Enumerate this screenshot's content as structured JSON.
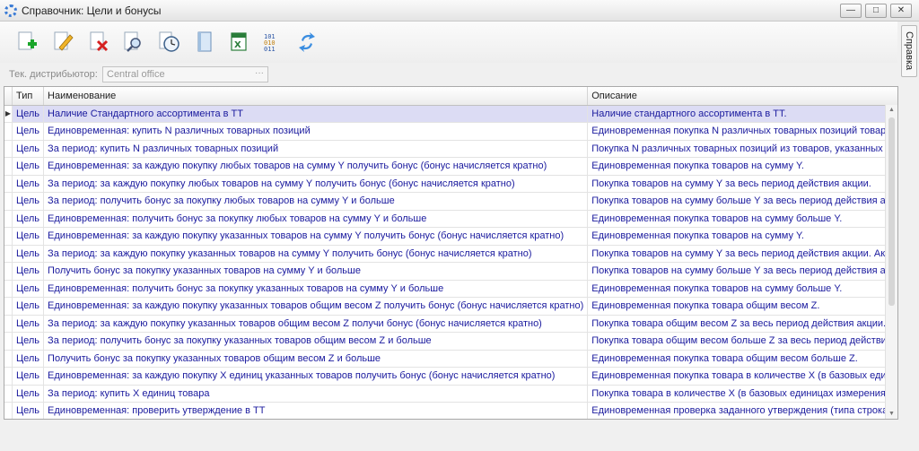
{
  "window": {
    "title": "Справочник: Цели и бонусы",
    "buttons": [
      "—",
      "□",
      "✕"
    ]
  },
  "toolbar": {
    "buttons": [
      {
        "icon": "add-icon"
      },
      {
        "icon": "edit-icon"
      },
      {
        "icon": "delete-icon"
      },
      {
        "icon": "search-edit-icon"
      },
      {
        "icon": "clock-icon"
      },
      {
        "icon": "book-icon"
      },
      {
        "icon": "excel-icon"
      },
      {
        "icon": "binary-icon"
      },
      {
        "icon": "refresh-icon"
      }
    ]
  },
  "distributor": {
    "label": "Тек. дистрибьютор:",
    "value": "Central office",
    "button": "···"
  },
  "side_tab": "Справка",
  "table": {
    "columns": [
      "Тип",
      "Наименование",
      "Описание"
    ],
    "rows": [
      {
        "type": "Цель",
        "name": "Наличие Стандартного ассортимента в ТТ",
        "desc": "Наличие стандартного ассортимента в ТТ."
      },
      {
        "type": "Цель",
        "name": "Единовременная: купить N различных товарных позиций",
        "desc": "Единовременная покупка N различных товарных позиций товаров, у..."
      },
      {
        "type": "Цель",
        "name": "За период: купить N различных товарных позиций",
        "desc": "Покупка N различных товарных позиций из товаров, указанных в це..."
      },
      {
        "type": "Цель",
        "name": "Единовременная: за каждую покупку любых товаров на сумму Y получить бонус (бонус начисляется кратно)",
        "desc": "Единовременная покупка товаров на сумму Y."
      },
      {
        "type": "Цель",
        "name": "За период: за каждую покупку любых товаров на сумму Y получить бонус (бонус начисляется кратно)",
        "desc": "Покупка товаров на сумму Y за весь период действия акции."
      },
      {
        "type": "Цель",
        "name": "За период: получить бонус за покупку любых товаров на сумму Y и больше",
        "desc": "Покупка товаров на сумму больше Y за весь период действия акции."
      },
      {
        "type": "Цель",
        "name": "Единовременная: получить бонус за покупку любых товаров на сумму Y и больше",
        "desc": "Единовременная покупка товаров на сумму больше Y."
      },
      {
        "type": "Цель",
        "name": "Единовременная: за каждую покупку указанных товаров на сумму Y получить бонус (бонус начисляется кратно)",
        "desc": "Единовременная покупка товаров на сумму Y."
      },
      {
        "type": "Цель",
        "name": "За период: за каждую покупку указанных товаров на сумму Y получить бонус (бонус начисляется кратно)",
        "desc": "Покупка товаров на сумму Y за весь период действия акции. Акция ..."
      },
      {
        "type": "Цель",
        "name": "Получить бонус за покупку указанных товаров на сумму Y и больше",
        "desc": "Покупка товаров на сумму больше Y за весь период действия акции."
      },
      {
        "type": "Цель",
        "name": "Единовременная: получить бонус за покупку указанных товаров на сумму Y и больше",
        "desc": "Единовременная покупка товаров на сумму больше Y."
      },
      {
        "type": "Цель",
        "name": "Единовременная: за каждую покупку указанных товаров общим весом Z получить бонус (бонус начисляется кратно)",
        "desc": "Единовременная покупка товара общим весом Z."
      },
      {
        "type": "Цель",
        "name": "За период: за каждую покупку указанных товаров общим весом Z получи бонус (бонус начисляется кратно)",
        "desc": "Покупка товара общим весом Z за весь период действия акции. Акц..."
      },
      {
        "type": "Цель",
        "name": "За период: получить бонус за покупку указанных товаров общим весом Z и больше",
        "desc": "Покупка товара общим весом больше Z за весь период действия акц..."
      },
      {
        "type": "Цель",
        "name": "Получить бонус за покупку указанных товаров общим весом Z и больше",
        "desc": "Единовременная покупка товара общим весом больше Z."
      },
      {
        "type": "Цель",
        "name": "Единовременная: за каждую покупку X единиц указанных товаров получить бонус (бонус начисляется кратно)",
        "desc": "Единовременная покупка товара в количестве X (в базовых единица..."
      },
      {
        "type": "Цель",
        "name": "За период: купить X единиц товара",
        "desc": "Покупка товара в количестве X (в базовых единицах измерения) за ..."
      },
      {
        "type": "Цель",
        "name": "Единовременная: проверить утверждение  в ТТ",
        "desc": "Единовременная проверка заданного утверждения (типа строка) в ..."
      }
    ]
  },
  "colors": {
    "selected_row": "#dcdcf4",
    "link_text": "#1a1a9e"
  }
}
